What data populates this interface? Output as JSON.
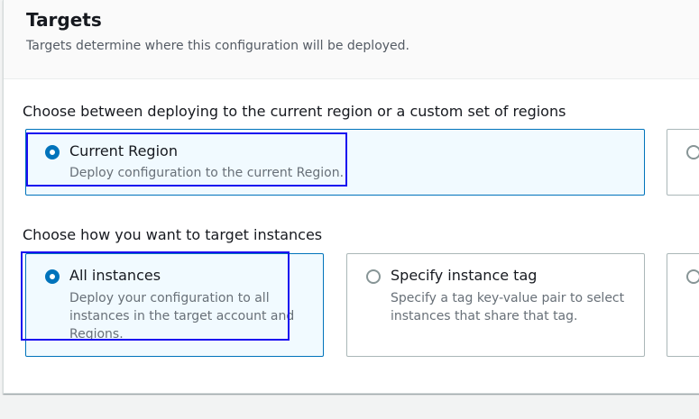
{
  "targets": {
    "title": "Targets",
    "description": "Targets determine where this configuration will be deployed."
  },
  "region_group": {
    "label": "Choose between deploying to the current region or a custom set of regions",
    "options": [
      {
        "title": "Current Region",
        "description": "Deploy configuration to the current Region.",
        "selected": true
      },
      {
        "title": "",
        "description": "",
        "selected": false
      }
    ]
  },
  "instance_group": {
    "label": "Choose how you want to target instances",
    "options": [
      {
        "title": "All instances",
        "description": "Deploy your configuration to all instances in the target account and Regions.",
        "selected": true
      },
      {
        "title": "Specify instance tag",
        "description": "Specify a tag key-value pair to select instances that share that tag.",
        "selected": false
      },
      {
        "title": "",
        "description": "",
        "selected": false
      }
    ]
  },
  "colors": {
    "accent": "#0073bb",
    "selected_tile_bg": "#f1faff",
    "highlight_box": "#1a0ef0"
  },
  "icons": [
    "radio-checked-icon",
    "radio-unchecked-icon"
  ]
}
